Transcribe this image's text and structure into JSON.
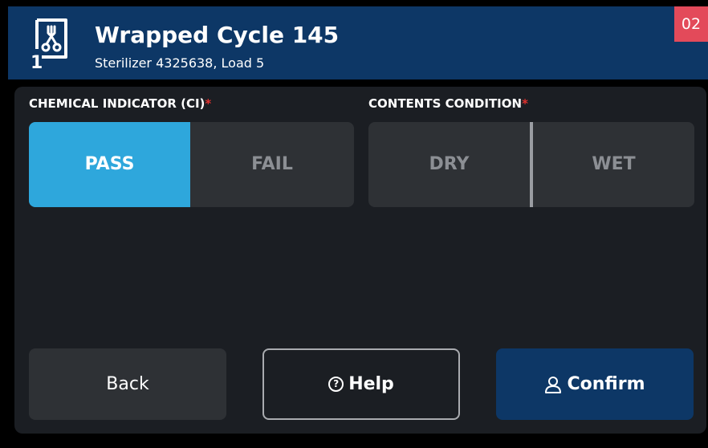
{
  "header": {
    "title": "Wrapped Cycle 145",
    "subtitle": "Sterilizer 4325638, Load 5",
    "badge": "02",
    "logo_icon": "sterilizer-tray-icon",
    "logo_digit": "1"
  },
  "sections": {
    "chemical_indicator": {
      "label": "CHEMICAL INDICATOR (CI)",
      "required_mark": "*",
      "options": [
        "PASS",
        "FAIL"
      ],
      "selected": "PASS"
    },
    "contents_condition": {
      "label": "CONTENTS CONDITION",
      "required_mark": "*",
      "options": [
        "DRY",
        "WET"
      ],
      "selected": null
    }
  },
  "buttons": {
    "back": "Back",
    "help": "Help",
    "help_icon": "question-circle-icon",
    "confirm": "Confirm",
    "confirm_icon": "user-icon"
  },
  "colors": {
    "header_bg": "#0d3766",
    "badge_bg": "#e34a5a",
    "selected_bg": "#2ea7dc",
    "required": "#e0312e",
    "confirm_bg": "#0d3766"
  }
}
